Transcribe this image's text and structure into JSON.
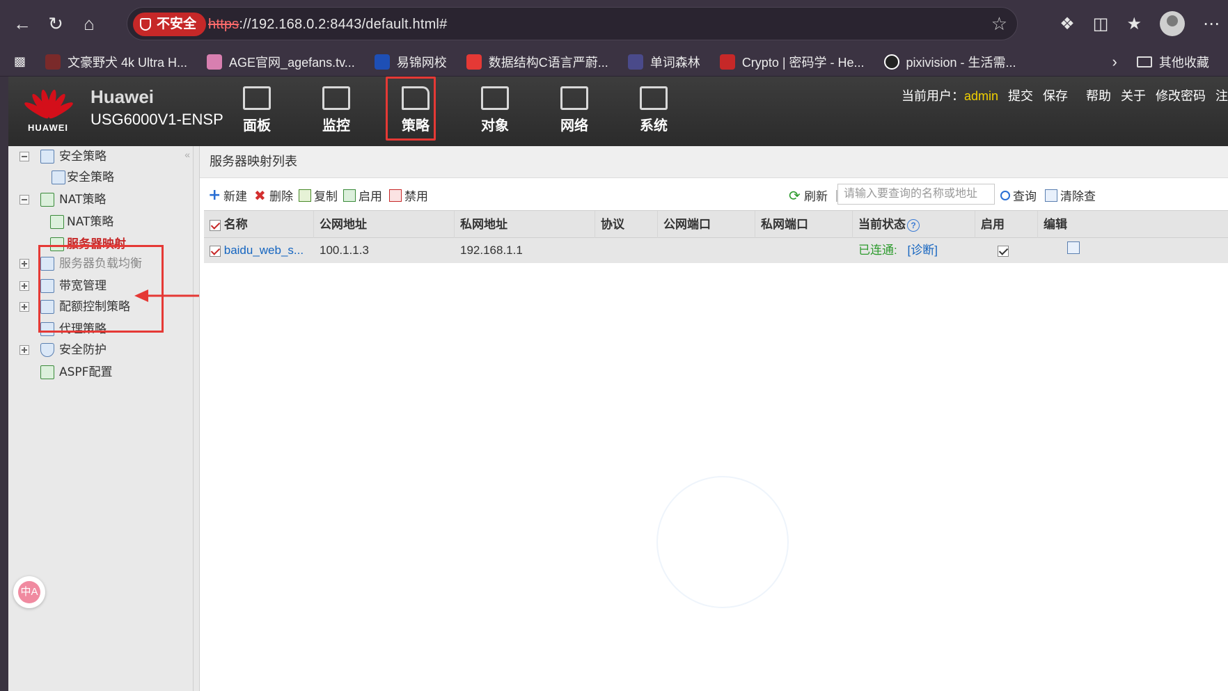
{
  "browser": {
    "insecure_label": "不安全",
    "url_scheme": "https",
    "url_rest": "://192.168.0.2:8443/default.html#",
    "bookmarks": [
      {
        "label": "文豪野犬 4k Ultra H...",
        "color": "#7a2a2a"
      },
      {
        "label": "AGE官网_agefans.tv...",
        "color": "#d87fb0"
      },
      {
        "label": "易锦网校",
        "color": "#1e4fb5"
      },
      {
        "label": "数据结构C语言严蔚...",
        "color": "#e53935"
      },
      {
        "label": "单词森林",
        "color": "#4a4a8a"
      },
      {
        "label": "Crypto | 密码学 - He...",
        "color": "#c62828"
      },
      {
        "label": "pixivision - 生活需...",
        "color": "#222222"
      }
    ],
    "other_bookmarks": "其他收藏"
  },
  "header": {
    "brand_line1": "Huawei",
    "brand_line2": "USG6000V1-ENSP",
    "logo_text": "HUAWEI",
    "nav": [
      {
        "label": "面板",
        "icon": "dashboard-icon"
      },
      {
        "label": "监控",
        "icon": "monitor-icon"
      },
      {
        "label": "策略",
        "icon": "policy-icon",
        "active": true
      },
      {
        "label": "对象",
        "icon": "object-icon"
      },
      {
        "label": "网络",
        "icon": "network-icon"
      },
      {
        "label": "系统",
        "icon": "system-icon"
      }
    ],
    "current_user_label": "当前用户：",
    "current_user": "admin",
    "links": [
      "提交",
      "保存",
      "帮助",
      "关于",
      "修改密码",
      "注"
    ]
  },
  "sidebar": {
    "items": [
      {
        "label": "安全策略",
        "level": 0,
        "toggle": "minus"
      },
      {
        "label": "安全策略",
        "level": 1
      },
      {
        "label": "NAT策略",
        "level": 0,
        "toggle": "minus"
      },
      {
        "label": "NAT策略",
        "level": 1
      },
      {
        "label": "服务器映射",
        "level": 1,
        "selected": true
      },
      {
        "label": "服务器负载均衡",
        "level": 0,
        "toggle": "plus"
      },
      {
        "label": "带宽管理",
        "level": 0,
        "toggle": "plus"
      },
      {
        "label": "配额控制策略",
        "level": 0,
        "toggle": "plus"
      },
      {
        "label": "代理策略",
        "level": 0
      },
      {
        "label": "安全防护",
        "level": 0,
        "toggle": "plus"
      },
      {
        "label": "ASPF配置",
        "level": 0
      }
    ],
    "translate_label": "中A"
  },
  "main": {
    "title": "服务器映射列表",
    "toolbar": {
      "new": "新建",
      "delete": "删除",
      "copy": "复制",
      "enable": "启用",
      "disable": "禁用",
      "refresh": "刷新",
      "search_placeholder": "请输入要查询的名称或地址",
      "query": "查询",
      "clear": "清除查"
    },
    "columns": [
      "名称",
      "公网地址",
      "私网地址",
      "协议",
      "公网端口",
      "私网端口",
      "当前状态",
      "启用",
      "编辑"
    ],
    "rows": [
      {
        "name": "baidu_web_s...",
        "public_addr": "100.1.1.3",
        "private_addr": "192.168.1.1",
        "protocol": "",
        "public_port": "",
        "private_port": "",
        "status": "已连通:",
        "diagnose": "[诊断]",
        "enabled": true
      }
    ]
  }
}
